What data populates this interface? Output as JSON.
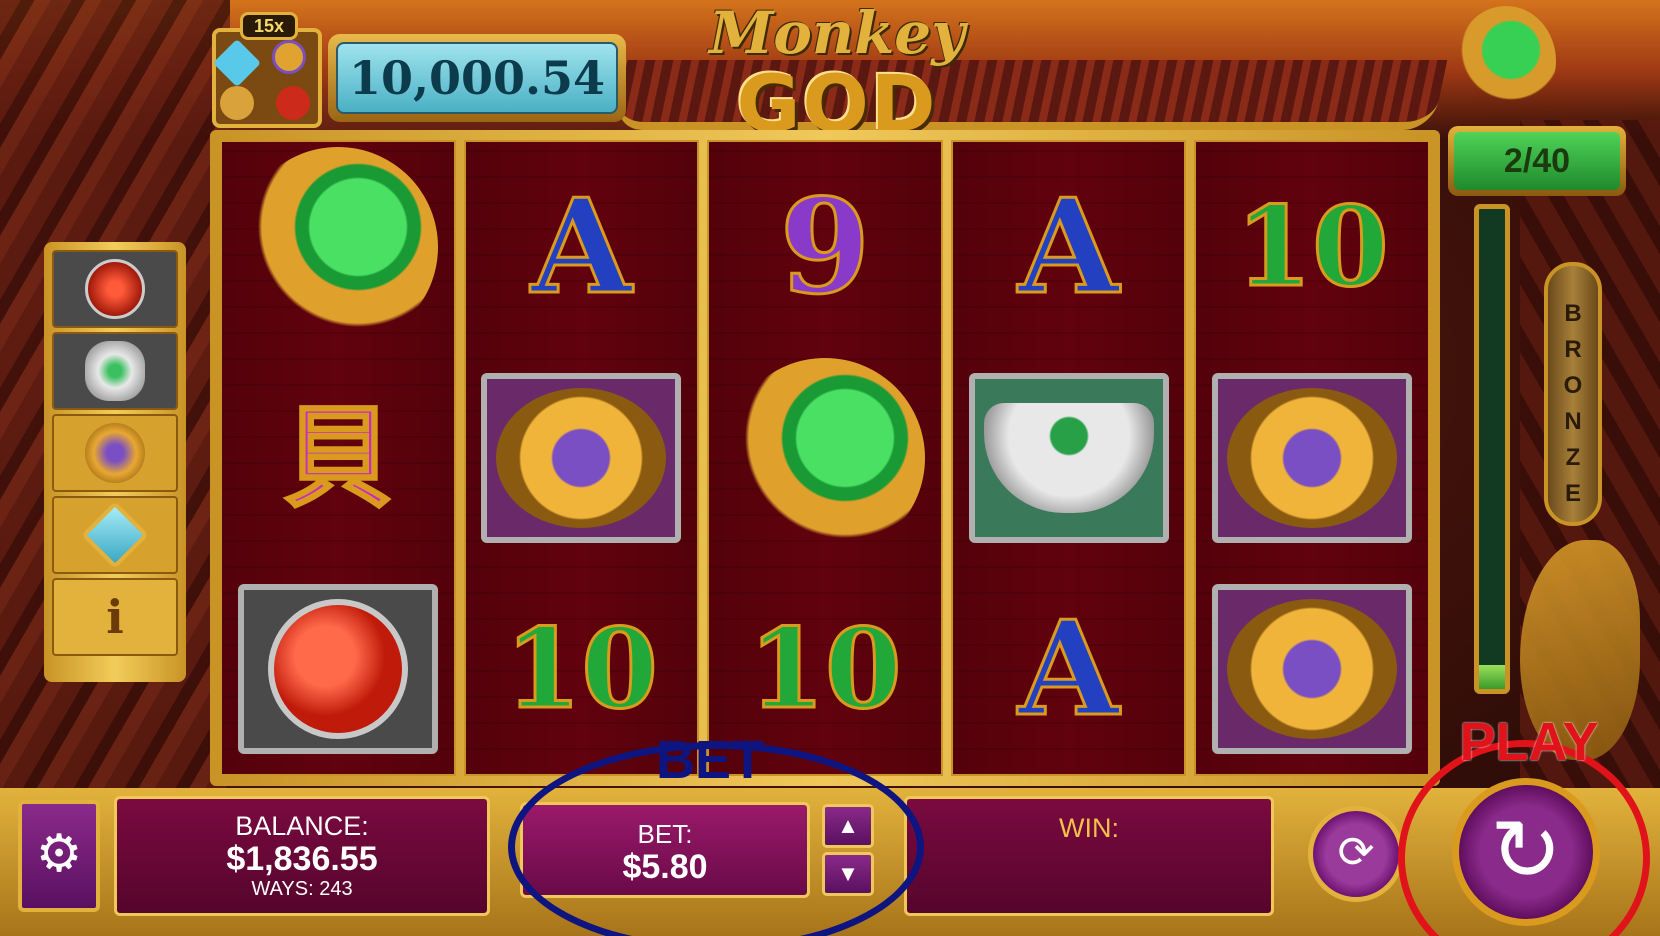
{
  "header": {
    "multiplier": "15x",
    "jackpot_value": "10,000.54",
    "logo_line1": "Monkey",
    "logo_line2": "GOD"
  },
  "free_spins": {
    "counter": "2/40",
    "level_label": "BRONZE",
    "progress_fraction": 0.05
  },
  "paytable": {
    "symbols": [
      "lantern-icon",
      "ingot-icon",
      "coins-icon",
      "gem-icon"
    ],
    "info_label": "i"
  },
  "reels": [
    [
      "koi-wild",
      "glyph:貝",
      "lantern-symbol"
    ],
    [
      "glyph:A",
      "coins-symbol",
      "glyph:10"
    ],
    [
      "glyph:9",
      "koi-wild",
      "glyph:10"
    ],
    [
      "glyph:A",
      "ingot-symbol",
      "glyph:A"
    ],
    [
      "glyph:10",
      "coins-symbol",
      "coins-symbol"
    ]
  ],
  "glyphs": {
    "reel1_row2": "貝",
    "reel2_row1": "A",
    "reel2_row3": "10",
    "reel3_row1": "9",
    "reel3_row3": "10",
    "reel4_row1": "A",
    "reel4_row3": "A",
    "reel5_row1": "10"
  },
  "annotations": {
    "bet_label": "BET",
    "play_label": "PLAY"
  },
  "bottom_bar": {
    "balance_label": "BALANCE:",
    "balance_value": "$1,836.55",
    "ways_label": "WAYS: 243",
    "bet_label": "BET:",
    "bet_value": "$5.80",
    "win_label": "WIN:",
    "win_value": ""
  },
  "colors": {
    "gold": "#e2b23c",
    "reel_bg": "#9a1438",
    "bet_annotation": "#0e1480",
    "play_annotation": "#e0121a"
  }
}
